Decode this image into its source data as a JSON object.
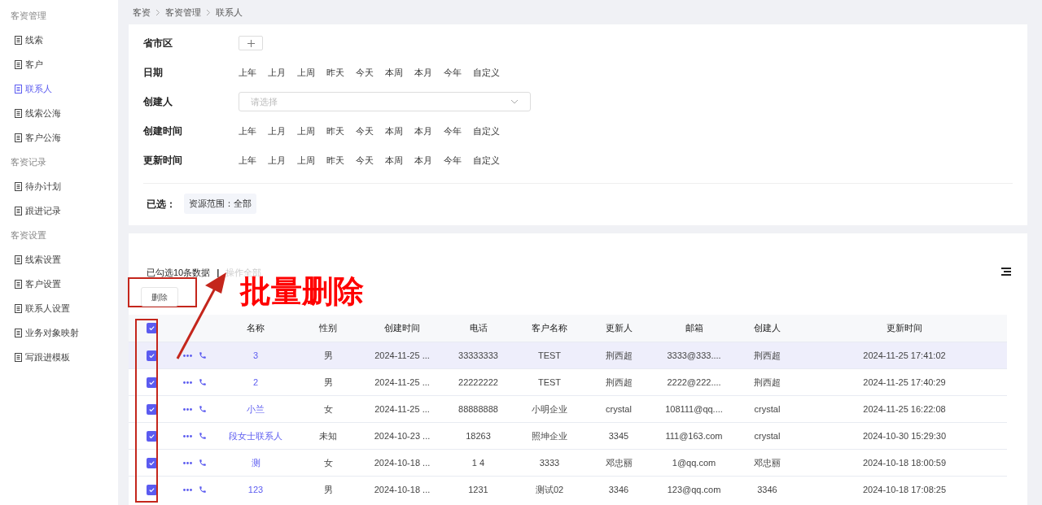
{
  "sidebar": {
    "groups": [
      {
        "title": "客资管理",
        "items": [
          {
            "label": "线索",
            "selected": false
          },
          {
            "label": "客户",
            "selected": false
          },
          {
            "label": "联系人",
            "selected": true
          },
          {
            "label": "线索公海",
            "selected": false
          },
          {
            "label": "客户公海",
            "selected": false
          }
        ]
      },
      {
        "title": "客资记录",
        "items": [
          {
            "label": "待办计划",
            "selected": false
          },
          {
            "label": "跟进记录",
            "selected": false
          }
        ]
      },
      {
        "title": "客资设置",
        "items": [
          {
            "label": "线索设置",
            "selected": false
          },
          {
            "label": "客户设置",
            "selected": false
          },
          {
            "label": "联系人设置",
            "selected": false
          },
          {
            "label": "业务对象映射",
            "selected": false
          },
          {
            "label": "写跟进模板",
            "selected": false
          }
        ]
      }
    ]
  },
  "breadcrumb": [
    "客资",
    "客资管理",
    "联系人"
  ],
  "filters": [
    {
      "kind": "add",
      "label": "省市区"
    },
    {
      "kind": "options",
      "label": "日期",
      "options": [
        "上年",
        "上月",
        "上周",
        "昨天",
        "今天",
        "本周",
        "本月",
        "今年",
        "自定义"
      ]
    },
    {
      "kind": "select",
      "label": "创建人",
      "placeholder": "请选择"
    },
    {
      "kind": "options",
      "label": "创建时间",
      "options": [
        "上年",
        "上月",
        "上周",
        "昨天",
        "今天",
        "本周",
        "本月",
        "今年",
        "自定义"
      ]
    },
    {
      "kind": "options",
      "label": "更新时间",
      "options": [
        "上年",
        "上月",
        "上周",
        "昨天",
        "今天",
        "本周",
        "本月",
        "今年",
        "自定义"
      ]
    }
  ],
  "selected_filters": {
    "label": "已选：",
    "tags": [
      "资源范围：全部"
    ]
  },
  "toolbar": {
    "selection_text": "已勾选10条数据",
    "separator": "|",
    "operate_all": "操作全部",
    "delete_button": "删除"
  },
  "annotation": {
    "text": "批量删除"
  },
  "table": {
    "all_checked": true,
    "columns": [
      "名称",
      "性别",
      "创建时间",
      "电话",
      "客户名称",
      "更新人",
      "邮箱",
      "创建人",
      "更新时间"
    ],
    "rows": [
      {
        "checked": true,
        "highlighted": true,
        "cells": [
          "3",
          "男",
          "2024-11-25 ...",
          "33333333",
          "TEST",
          "荆西超",
          "3333@333....",
          "荆西超",
          "2024-11-25 17:41:02"
        ]
      },
      {
        "checked": true,
        "highlighted": false,
        "cells": [
          "2",
          "男",
          "2024-11-25 ...",
          "22222222",
          "TEST",
          "荆西超",
          "2222@222....",
          "荆西超",
          "2024-11-25 17:40:29"
        ]
      },
      {
        "checked": true,
        "highlighted": false,
        "cells": [
          "小兰",
          "女",
          "2024-11-25 ...",
          "88888888",
          "小明企业",
          "crystal",
          "108111@qq....",
          "crystal",
          "2024-11-25 16:22:08"
        ]
      },
      {
        "checked": true,
        "highlighted": false,
        "cells": [
          "段女士联系人",
          "未知",
          "2024-10-23 ...",
          "18263",
          "照坤企业",
          "3345",
          "111@163.com",
          "crystal",
          "2024-10-30 15:29:30"
        ]
      },
      {
        "checked": true,
        "highlighted": false,
        "cells": [
          "测",
          "女",
          "2024-10-18 ...",
          "1 4",
          "3333",
          "邓忠丽",
          "1@qq.com",
          "邓忠丽",
          "2024-10-18 18:00:59"
        ]
      },
      {
        "checked": true,
        "highlighted": false,
        "cells": [
          "123",
          "男",
          "2024-10-18 ...",
          "1231",
          "测试02",
          "3346",
          "123@qq.com",
          "3346",
          "2024-10-18 17:08:25"
        ]
      }
    ]
  }
}
